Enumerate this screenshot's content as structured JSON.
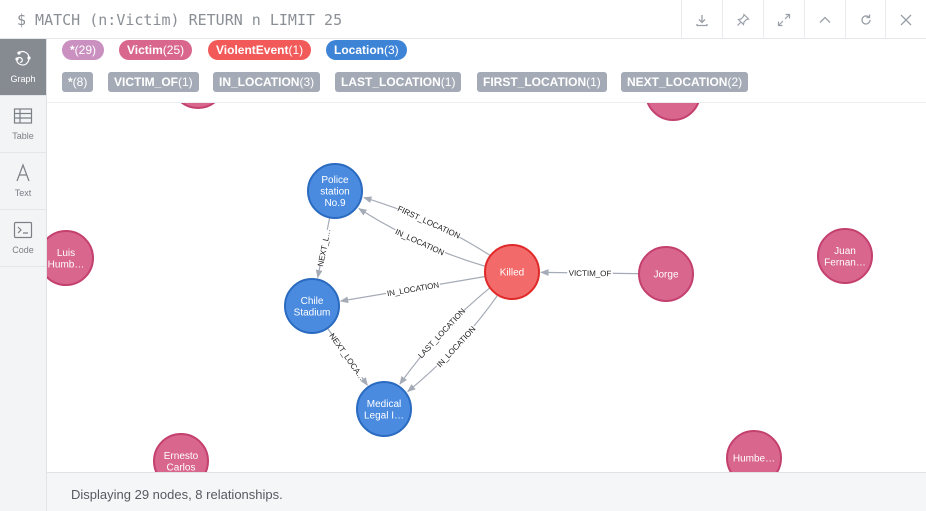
{
  "query": {
    "text": "$ MATCH (n:Victim) RETURN n LIMIT 25"
  },
  "toolbar": {
    "buttons": [
      "download-icon",
      "pin-icon",
      "expand-icon",
      "collapse-up-icon",
      "rerun-icon",
      "close-icon"
    ]
  },
  "sidebar": {
    "items": [
      {
        "label": "Graph",
        "icon": "graph-icon",
        "active": true
      },
      {
        "label": "Table",
        "icon": "table-icon",
        "active": false
      },
      {
        "label": "Text",
        "icon": "text-icon",
        "active": false
      },
      {
        "label": "Code",
        "icon": "code-icon",
        "active": false
      }
    ]
  },
  "labels": [
    {
      "name": "*",
      "count": "(29)",
      "color": "#c990c0"
    },
    {
      "name": "Victim",
      "count": "(25)",
      "color": "#d9668d"
    },
    {
      "name": "ViolentEvent",
      "count": "(1)",
      "color": "#f25a5a"
    },
    {
      "name": "Location",
      "count": "(3)",
      "color": "#3e84d6"
    }
  ],
  "relationships": [
    {
      "name": "*",
      "count": "(8)"
    },
    {
      "name": "VICTIM_OF",
      "count": "(1)"
    },
    {
      "name": "IN_LOCATION",
      "count": "(3)"
    },
    {
      "name": "LAST_LOCATION",
      "count": "(1)"
    },
    {
      "name": "FIRST_LOCATION",
      "count": "(1)"
    },
    {
      "name": "NEXT_LOCATION",
      "count": "(2)"
    }
  ],
  "colors": {
    "victim_fill": "#d9668d",
    "victim_stroke": "#c3406f",
    "event_fill": "#f36a6a",
    "event_stroke": "#e02a2a",
    "location_fill": "#4a8be0",
    "location_stroke": "#2a6bc0"
  },
  "graph": {
    "nodes": [
      {
        "id": "police",
        "type": "location",
        "lines": [
          "Police",
          "station",
          "No.9"
        ]
      },
      {
        "id": "chile",
        "type": "location",
        "lines": [
          "Chile",
          "Stadium"
        ]
      },
      {
        "id": "medical",
        "type": "location",
        "lines": [
          "Medical",
          "Legal I…"
        ]
      },
      {
        "id": "killed",
        "type": "event",
        "lines": [
          "Killed"
        ]
      },
      {
        "id": "jorge",
        "type": "victim",
        "lines": [
          "Jorge"
        ]
      },
      {
        "id": "luis",
        "type": "victim",
        "lines": [
          "Luis",
          "Humb…"
        ]
      },
      {
        "id": "juan",
        "type": "victim",
        "lines": [
          "Juan",
          "Fernan…"
        ]
      },
      {
        "id": "ernesto",
        "type": "victim",
        "lines": [
          "Ernesto",
          "Carlos"
        ]
      },
      {
        "id": "humbe",
        "type": "victim",
        "lines": [
          "Humbe…"
        ]
      },
      {
        "id": "top1",
        "type": "victim",
        "lines": []
      },
      {
        "id": "top2",
        "type": "victim",
        "lines": []
      }
    ],
    "edges": [
      {
        "from": "jorge",
        "to": "killed",
        "label": "VICTIM_OF"
      },
      {
        "from": "killed",
        "to": "police",
        "label": "IN_LOCATION"
      },
      {
        "from": "killed",
        "to": "police",
        "label": "FIRST_LOCATION"
      },
      {
        "from": "killed",
        "to": "chile",
        "label": "IN_LOCATION"
      },
      {
        "from": "killed",
        "to": "medical",
        "label": "IN_LOCATION"
      },
      {
        "from": "killed",
        "to": "medical",
        "label": "LAST_LOCATION"
      },
      {
        "from": "police",
        "to": "chile",
        "label": "NEXT_L…"
      },
      {
        "from": "chile",
        "to": "medical",
        "label": "NEXT_LOCA…"
      }
    ]
  },
  "footer": {
    "text": "Displaying 29 nodes, 8 relationships."
  }
}
